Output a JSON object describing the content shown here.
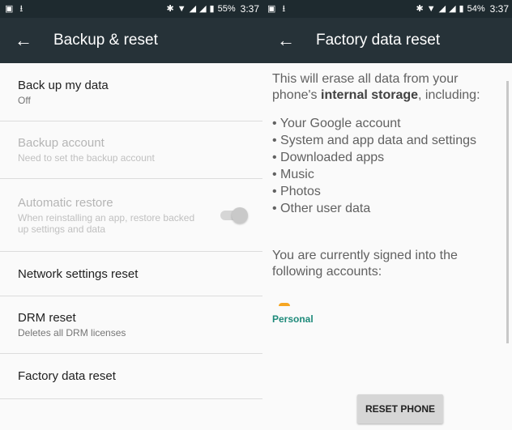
{
  "left": {
    "status": {
      "battery_pct": "55%",
      "time": "3:37"
    },
    "appbar": {
      "title": "Backup & reset"
    },
    "items": [
      {
        "title": "Back up my data",
        "sub": "Off"
      },
      {
        "title": "Backup account",
        "sub": "Need to set the backup account"
      },
      {
        "title": "Automatic restore",
        "sub": "When reinstalling an app, restore backed up settings and data"
      },
      {
        "title": "Network settings reset"
      },
      {
        "title": "DRM reset",
        "sub": "Deletes all DRM licenses"
      },
      {
        "title": "Factory data reset"
      }
    ]
  },
  "right": {
    "status": {
      "battery_pct": "54%",
      "time": "3:37"
    },
    "appbar": {
      "title": "Factory data reset"
    },
    "intro_prefix": "This will erase all data from your phone's ",
    "intro_bold": "internal storage",
    "intro_suffix": ", including:",
    "bullets": [
      "Your Google account",
      "System and app data and settings",
      "Downloaded apps",
      "Music",
      "Photos",
      "Other user data"
    ],
    "signed_in": "You are currently signed into the following accounts:",
    "account_label": "Personal",
    "button_label": "RESET PHONE"
  }
}
